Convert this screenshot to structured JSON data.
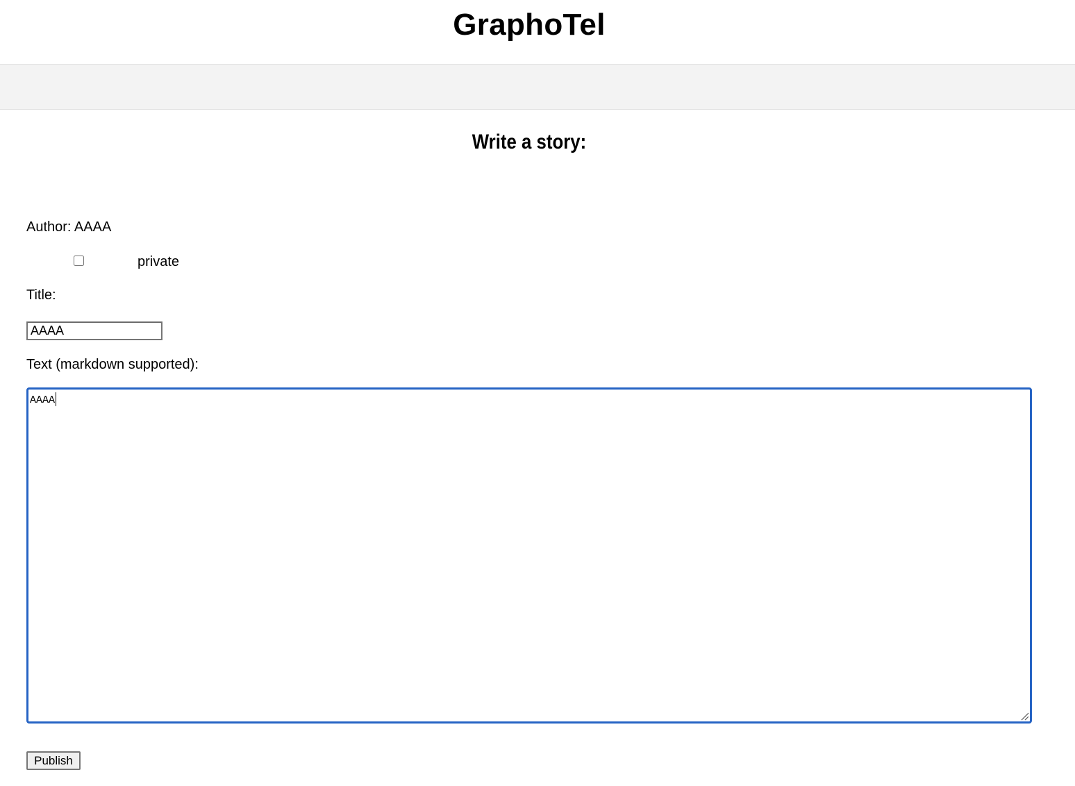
{
  "header": {
    "site_title": "GraphoTel"
  },
  "form": {
    "heading": "Write a story:",
    "author_line": "Author: AAAA",
    "private_label": "private",
    "private_checked": false,
    "title_label": "Title:",
    "title_value": "AAAA",
    "text_label": "Text (markdown supported):",
    "text_value": "AAAA",
    "publish_label": "Publish"
  },
  "colors": {
    "focus_border": "#2563c4",
    "navbar_bg": "#f3f3f3"
  }
}
